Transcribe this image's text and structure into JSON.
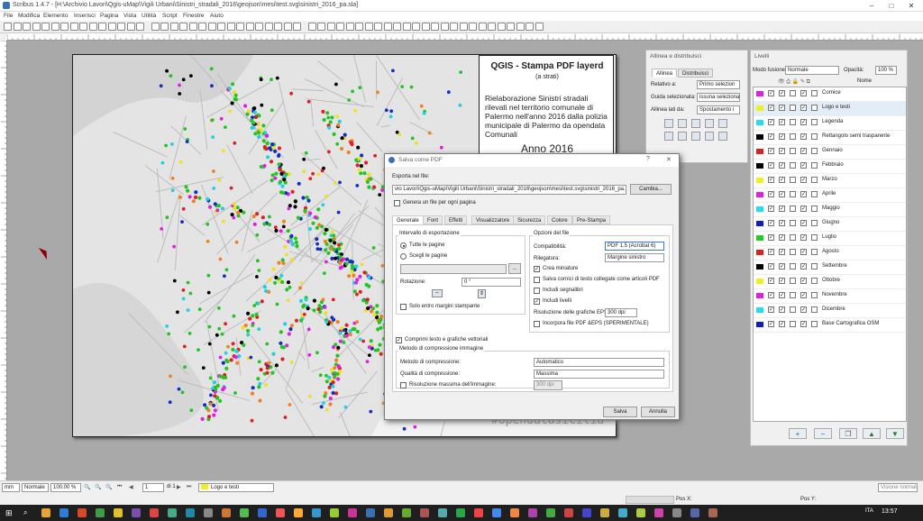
{
  "window": {
    "title": "Scribus 1.4.7 - [H:\\Archivio Lavori\\Qgis-uMap\\Vigili Urbani\\Sinistri_stradali_2016\\geojson\\mesi\\test.svg\\sinistri_2016_pa.sla]",
    "minimize": "–",
    "maximize": "□",
    "close": "✕"
  },
  "menu": [
    "File",
    "Modifica",
    "Elemento",
    "Inserisci",
    "Pagina",
    "Vista",
    "Utilità",
    "Script",
    "Finestre",
    "Aiuto"
  ],
  "page": {
    "title": "QGIS - Stampa PDF layerd",
    "subtitle": "(a strati)",
    "description": "Rielaborazione Sinistri stradali rilevati nel territorio comunale di Palermo nell'anno 2016 dalla polizia municipale di Palermo da opendata Comunali",
    "year": "Anno 2016",
    "hashtag": "#opendatasicilia"
  },
  "align_panel": {
    "title": "Allinea e distribuisci",
    "tabs": [
      "Allinea",
      "Distribuisci"
    ],
    "relative_label": "Relativo a:",
    "relative_value": "Primo selezion",
    "guide_label": "Guida selezionata:",
    "guide_value": "issuna selezionata",
    "sides_label": "Allinea lati da:",
    "sides_value": "Spostamento i"
  },
  "layers_panel": {
    "title": "Livelli",
    "blend_label": "Modo fusione:",
    "blend_value": "Normale",
    "opacity_label": "Opacità:",
    "opacity_value": "100 %",
    "name_header": "Nome",
    "layers": [
      {
        "name": "Cornice",
        "color": "#e020e0"
      },
      {
        "name": "Logo e testi",
        "color": "#f0f020"
      },
      {
        "name": "Legenda",
        "color": "#20e0f0"
      },
      {
        "name": "Rettangolo semi trasparente",
        "color": "#000000"
      },
      {
        "name": "Gennaio",
        "color": "#e02020"
      },
      {
        "name": "Febbraio",
        "color": "#000000"
      },
      {
        "name": "Marzo",
        "color": "#f0f020"
      },
      {
        "name": "Aprile",
        "color": "#e020e0"
      },
      {
        "name": "Maggio",
        "color": "#20e0f0"
      },
      {
        "name": "Giugno",
        "color": "#1020c0"
      },
      {
        "name": "Luglio",
        "color": "#20d020"
      },
      {
        "name": "Agosto",
        "color": "#e02020"
      },
      {
        "name": "Settembre",
        "color": "#000000"
      },
      {
        "name": "Ottobre",
        "color": "#f0f020"
      },
      {
        "name": "Novembre",
        "color": "#e020e0"
      },
      {
        "name": "Dicembre",
        "color": "#20e0f0"
      },
      {
        "name": "Base Cartografica OSM",
        "color": "#1020c0"
      }
    ],
    "buttons": [
      "+",
      "−",
      "❐",
      "▲",
      "▼"
    ]
  },
  "dialog": {
    "title": "Salva come PDF",
    "help": "?",
    "close": "✕",
    "export_label": "Esporta nel file:",
    "file_path": "vio Lavori\\Qgis-uMap\\Vigili Urbani\\Sinistri_stradali_2016\\geojson\\mesi\\test.svg\\sinistri_2016_pa.pdf",
    "change_button": "Cambia...",
    "one_file_per_page": "Genera un file per ogni pagina",
    "tabs": [
      "Generale",
      "Font",
      "Effetti",
      "Visualizzatore",
      "Sicurezza",
      "Colore",
      "Pre-Stampa"
    ],
    "range_group": "Intervallo di esportazione",
    "all_pages": "Tutte le pagine",
    "choose_pages": "Scegli le pagine",
    "browse": "...",
    "rotation_label": "Rotazione:",
    "rotation_value": "0 °",
    "margins_only": "Solo entro margini stampante",
    "file_options_group": "Opzioni del file",
    "compat_label": "Compatibilità:",
    "compat_value": "PDF 1.5 (Acrobat 6)",
    "binding_label": "Rilegatura:",
    "binding_value": "Margine sinistro",
    "thumbnails": "Crea miniature",
    "save_linked": "Salva cornici di testo collegate come articoli PDF",
    "bookmarks": "Includi segnalibri",
    "include_layers": "Includi livelli",
    "eps_res_label": "Risoluzione delle grafiche EPS:",
    "eps_res_value": "300 dpi",
    "embed_pdf": "Incorpora file PDF &EPS (SPERIMENTALE)",
    "compress_vector": "Comprimi testo e grafiche vettoriali",
    "compression_group": "Metodo di compressione immagine",
    "comp_method_label": "Metodo di compressione:",
    "comp_method_value": "Automatico",
    "comp_quality_label": "Qualità di compressione:",
    "comp_quality_value": "Massima",
    "max_res_label": "Risoluzione massima dell'immagine:",
    "max_res_value": "300 dpi",
    "save_button": "Salva",
    "cancel_button": "Annulla"
  },
  "statusbar": {
    "unit": "mm",
    "mode": "Normale",
    "zoom": "100.00 %",
    "page_num": "1",
    "page_of": "di 1",
    "layer": "Logo e testi",
    "pos_x": "Pos X:",
    "pos_y": "Pos Y:",
    "preview": "Visione normale"
  },
  "taskbar": {
    "time": "13:57",
    "lang": "ITA"
  },
  "colors": {
    "selection": "#e3edf8",
    "dialog_bg": "#f0f0f0",
    "canvas_bg": "#a9a9a9"
  }
}
